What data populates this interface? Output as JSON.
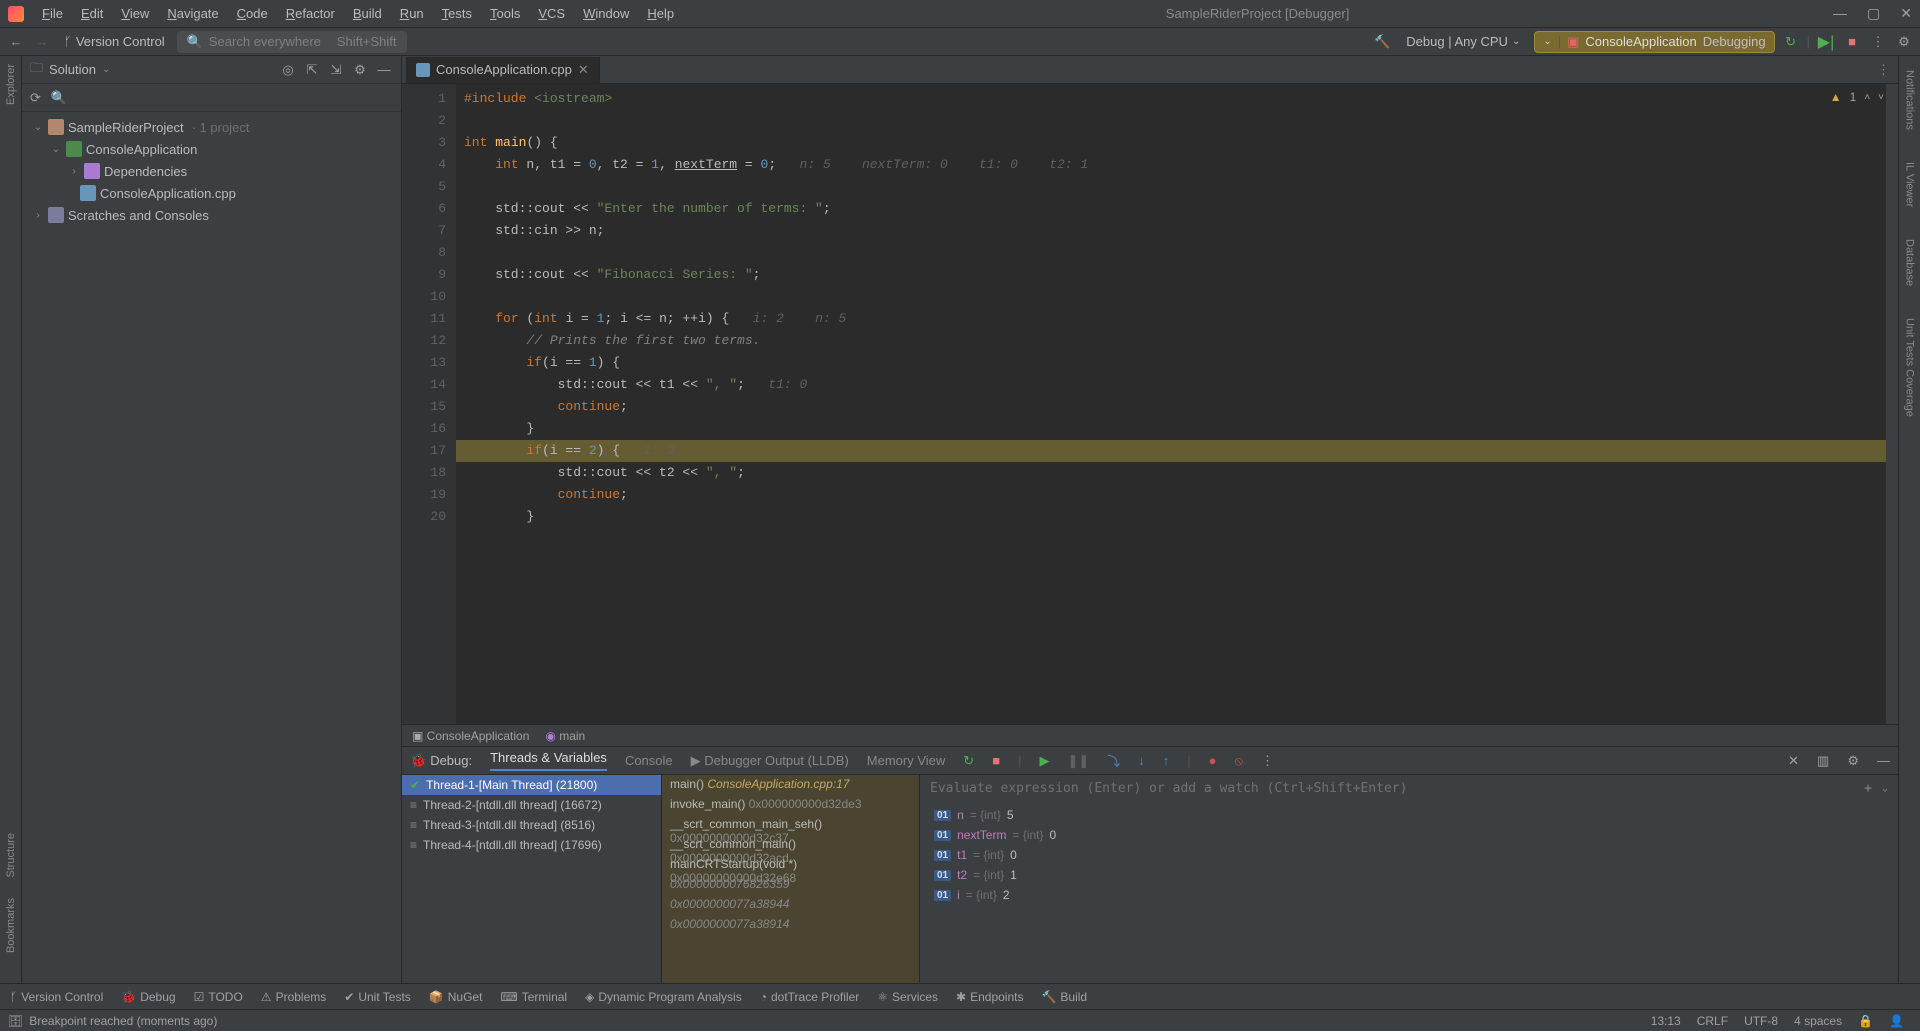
{
  "window": {
    "title": "SampleRiderProject [Debugger]",
    "menu": [
      "File",
      "Edit",
      "View",
      "Navigate",
      "Code",
      "Refactor",
      "Build",
      "Run",
      "Tests",
      "Tools",
      "VCS",
      "Window",
      "Help"
    ]
  },
  "toolbar": {
    "back": "←",
    "fwd": "→",
    "version_control": "Version Control",
    "search_placeholder": "Search everywhere",
    "search_shortcut": "Shift+Shift",
    "run_config": "Debug | Any CPU",
    "context_app": "ConsoleApplication",
    "context_state": "Debugging"
  },
  "explorer": {
    "label": "Solution",
    "header_icons": [
      "target",
      "collapse",
      "sort",
      "gear",
      "minimize"
    ],
    "root": "SampleRiderProject",
    "root_hint": "· 1 project",
    "project": "ConsoleApplication",
    "dependencies": "Dependencies",
    "source_file": "ConsoleApplication.cpp",
    "scratches": "Scratches and Consoles"
  },
  "left_strip": [
    "Explorer"
  ],
  "left_strip_bottom": [
    "Structure",
    "Bookmarks"
  ],
  "right_strip": [
    "Notifications",
    "IL Viewer",
    "Database",
    "Unit Tests Coverage"
  ],
  "editor": {
    "tab_label": "ConsoleApplication.cpp",
    "warnings_count": "1",
    "breadcrumbs": [
      "ConsoleApplication",
      "main"
    ],
    "current_exec_line": 17,
    "code": [
      {
        "n": 1,
        "html": "<span class='kw'>#include</span> <span class='inc'>&lt;iostream&gt;</span>"
      },
      {
        "n": 2,
        "html": ""
      },
      {
        "n": 3,
        "html": "<span class='kw'>int</span> <span class='fn'>main</span>() {"
      },
      {
        "n": 4,
        "html": "    <span class='kw'>int</span> n, t1 = <span class='num'>0</span>, t2 = <span class='num'>1</span>, <u>nextTerm</u> = <span class='num'>0</span>;   <span class='hint'>n: 5    nextTerm: 0    t1: 0    t2: 1</span>"
      },
      {
        "n": 5,
        "html": ""
      },
      {
        "n": 6,
        "html": "    std::cout &lt;&lt; <span class='str'>\"Enter the number of terms: \"</span>;"
      },
      {
        "n": 7,
        "html": "    std::cin &gt;&gt; n;"
      },
      {
        "n": 8,
        "html": ""
      },
      {
        "n": 9,
        "html": "    std::cout &lt;&lt; <span class='str'>\"Fibonacci Series: \"</span>;"
      },
      {
        "n": 10,
        "html": ""
      },
      {
        "n": 11,
        "html": "    <span class='kw'>for</span> (<span class='kw'>int</span> i = <span class='num'>1</span>; i &lt;= n; ++i) {   <span class='hint'>i: 2    n: 5</span>"
      },
      {
        "n": 12,
        "html": "        <span class='com'>// Prints the first two terms.</span>"
      },
      {
        "n": 13,
        "html": "        <span class='kw'>if</span>(i == <span class='num'>1</span>) {"
      },
      {
        "n": 14,
        "html": "            std::cout &lt;&lt; t1 &lt;&lt; <span class='str'>\", \"</span>;   <span class='hint'>t1: 0</span>"
      },
      {
        "n": 15,
        "html": "            <span class='kw'>continue</span>;"
      },
      {
        "n": 16,
        "html": "        }"
      },
      {
        "n": 17,
        "html": "        <span class='kw'>if</span>(i == <span class='num'>2</span>) {   <span class='hint'>i: 2</span>"
      },
      {
        "n": 18,
        "html": "            std::cout &lt;&lt; t2 &lt;&lt; <span class='str'>\", \"</span>;"
      },
      {
        "n": 19,
        "html": "            <span class='kw'>continue</span>;"
      },
      {
        "n": 20,
        "html": "        }"
      }
    ]
  },
  "debug": {
    "label": "Debug:",
    "tabs": [
      "Threads & Variables",
      "Console",
      "Debugger Output (LLDB)",
      "Memory View"
    ],
    "active_tab": 0,
    "threads": [
      {
        "label": "Thread-1-[Main Thread] (21800)",
        "selected": true
      },
      {
        "label": "Thread-2-[ntdll.dll thread] (16672)"
      },
      {
        "label": "Thread-3-[ntdll.dll thread] (8516)"
      },
      {
        "label": "Thread-4-[ntdll.dll thread] (17696)"
      }
    ],
    "frames": [
      {
        "fn": "main()",
        "loc": "ConsoleApplication.cpp:17",
        "top": true
      },
      {
        "fn": "invoke_main()",
        "loc": "0x000000000d32de3"
      },
      {
        "fn": "__scrt_common_main_seh()",
        "loc": "0x0000000000d32c37"
      },
      {
        "fn": "__scrt_common_main()",
        "loc": "0x0000000000d32acd"
      },
      {
        "fn": "mainCRTStartup(void *)",
        "loc": "0x00000000000d32e68"
      },
      {
        "fn": "<unknown>",
        "loc": "0x0000000076826359",
        "unk": true
      },
      {
        "fn": "<unknown>",
        "loc": "0x0000000077a38944",
        "unk": true
      },
      {
        "fn": "<unknown>",
        "loc": "0x0000000077a38914",
        "unk": true
      }
    ],
    "eval_placeholder": "Evaluate expression (Enter) or add a watch (Ctrl+Shift+Enter)",
    "vars": [
      {
        "name": "n",
        "type": "{int}",
        "val": "5"
      },
      {
        "name": "nextTerm",
        "type": "{int}",
        "val": "0"
      },
      {
        "name": "t1",
        "type": "{int}",
        "val": "0"
      },
      {
        "name": "t2",
        "type": "{int}",
        "val": "1"
      },
      {
        "name": "i",
        "type": "{int}",
        "val": "2"
      }
    ]
  },
  "bottom_tools": [
    "Version Control",
    "Debug",
    "TODO",
    "Problems",
    "Unit Tests",
    "NuGet",
    "Terminal",
    "Dynamic Program Analysis",
    "dotTrace Profiler",
    "Services",
    "Endpoints",
    "Build"
  ],
  "status": {
    "msg": "Breakpoint reached (moments ago)",
    "pos": "13:13",
    "eol": "CRLF",
    "enc": "UTF-8",
    "indent": "4 spaces"
  }
}
